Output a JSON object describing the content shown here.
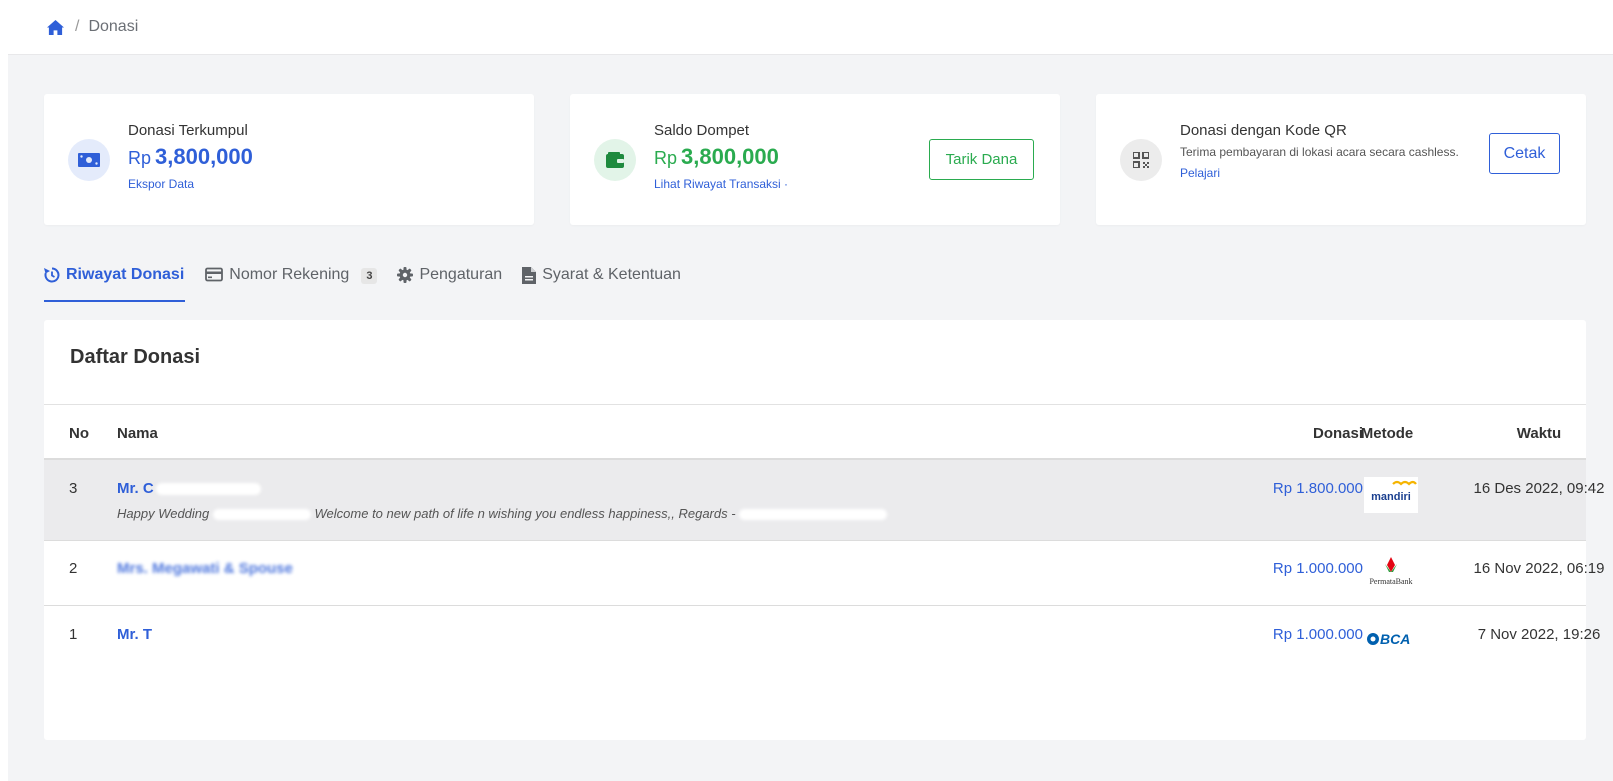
{
  "breadcrumb": {
    "current": "Donasi"
  },
  "cards": {
    "collected": {
      "label": "Donasi Terkumpul",
      "currency": "Rp",
      "amount": "3,800,000",
      "link": "Ekspor Data"
    },
    "wallet": {
      "label": "Saldo Dompet",
      "currency": "Rp",
      "amount": "3,800,000",
      "link": "Lihat Riwayat Transaksi ·",
      "button": "Tarik Dana"
    },
    "qr": {
      "label": "Donasi dengan Kode QR",
      "desc": "Terima pembayaran di lokasi acara secara cashless.",
      "link": "Pelajari",
      "button": "Cetak"
    }
  },
  "tabs": [
    {
      "label": "Riwayat Donasi",
      "icon": "history-icon",
      "active": true
    },
    {
      "label": "Nomor Rekening",
      "icon": "credit-card-icon",
      "count": "3"
    },
    {
      "label": "Pengaturan",
      "icon": "gear-icon"
    },
    {
      "label": "Syarat & Ketentuan",
      "icon": "document-icon"
    }
  ],
  "table": {
    "title": "Daftar Donasi",
    "headers": {
      "no": "No",
      "nama": "Nama",
      "donasi": "Donasi",
      "metode": "Metode",
      "waktu": "Waktu"
    },
    "rows": [
      {
        "no": "3",
        "name": "Mr. C",
        "message_start": "Happy Wedding",
        "message_mid": "Welcome to new path of life n wishing you endless happiness,, Regards -",
        "amount": "Rp 1.800.000",
        "method": "mandiri",
        "time": "16 Des 2022, 09:42"
      },
      {
        "no": "2",
        "name": "Mrs. Megawati & Spouse",
        "amount": "Rp 1.000.000",
        "method": "PermataBank",
        "time": "16 Nov 2022, 06:19"
      },
      {
        "no": "1",
        "name": "Mr. T",
        "amount": "Rp 1.000.000",
        "method": "BCA",
        "time": "7 Nov 2022, 19:26"
      }
    ]
  },
  "colors": {
    "primary": "#2f5fd8",
    "success": "#2aab4f",
    "background": "#f3f4f6"
  }
}
